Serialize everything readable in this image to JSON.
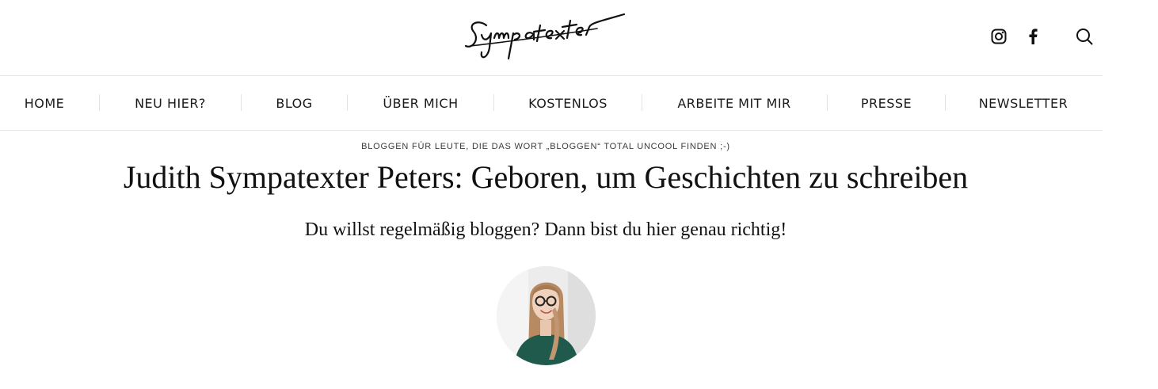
{
  "header": {
    "logo_text": "Sympatexter",
    "social": {
      "instagram_icon": "instagram-icon",
      "facebook_icon": "facebook-icon",
      "search_icon": "search-icon"
    }
  },
  "nav": {
    "items": [
      {
        "label": "HOME"
      },
      {
        "label": "NEU HIER?"
      },
      {
        "label": "BLOG"
      },
      {
        "label": "ÜBER MICH"
      },
      {
        "label": "KOSTENLOS"
      },
      {
        "label": "ARBEITE MIT MIR"
      },
      {
        "label": "PRESSE"
      },
      {
        "label": "NEWSLETTER"
      }
    ]
  },
  "hero": {
    "tagline": "BLOGGEN FÜR LEUTE, DIE DAS WORT „BLOGGEN“ TOTAL UNCOOL FINDEN ;-)",
    "title": "Judith Sympatexter Peters: Geboren, um Geschichten zu schreiben",
    "subtitle": "Du willst regelmäßig bloggen? Dann bist du hier genau richtig!",
    "avatar_icon": "portrait-photo"
  },
  "colors": {
    "text": "#111111",
    "border": "#e6e6e6",
    "avatar_sweater": "#1f5a4d"
  }
}
